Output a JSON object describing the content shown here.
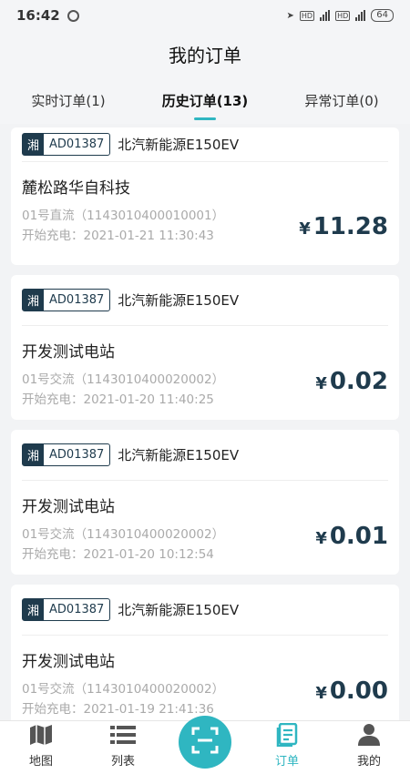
{
  "status": {
    "time": "16:42",
    "battery": "64"
  },
  "header": {
    "title": "我的订单"
  },
  "tabs": [
    {
      "label": "实时订单(1)"
    },
    {
      "label": "历史订单(13)",
      "active": true
    },
    {
      "label": "异常订单(0)"
    }
  ],
  "orders": [
    {
      "province": "湘",
      "plate": "AD01387",
      "model": "北汽新能源E150EV",
      "station": "麓松路华自科技",
      "pile": "01号直流（1143010400010001）",
      "start": "开始充电：2021-01-21 11:30:43",
      "currency": "¥",
      "amount": "11.28"
    },
    {
      "province": "湘",
      "plate": "AD01387",
      "model": "北汽新能源E150EV",
      "station": "开发测试电站",
      "pile": "01号交流（1143010400020002）",
      "start": "开始充电：2021-01-20 11:40:25",
      "currency": "¥",
      "amount": "0.02"
    },
    {
      "province": "湘",
      "plate": "AD01387",
      "model": "北汽新能源E150EV",
      "station": "开发测试电站",
      "pile": "01号交流（1143010400020002）",
      "start": "开始充电：2021-01-20 10:12:54",
      "currency": "¥",
      "amount": "0.01"
    },
    {
      "province": "湘",
      "plate": "AD01387",
      "model": "北汽新能源E150EV",
      "station": "开发测试电站",
      "pile": "01号交流（1143010400020002）",
      "start": "开始充电：2021-01-19 21:41:36",
      "currency": "¥",
      "amount": "0.00"
    }
  ],
  "nav": [
    {
      "label": "地图",
      "icon": "map-icon"
    },
    {
      "label": "列表",
      "icon": "list-icon"
    },
    {
      "label": "订单",
      "icon": "order-icon",
      "active": true
    },
    {
      "label": "我的",
      "icon": "user-icon"
    }
  ],
  "scan": {
    "icon": "scan-icon"
  },
  "colors": {
    "accent": "#2fb6c1",
    "price": "#1f3b4d"
  }
}
